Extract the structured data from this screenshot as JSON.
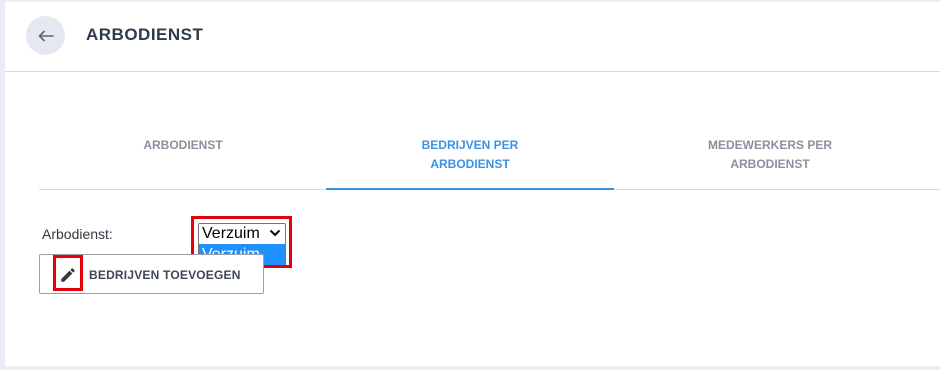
{
  "header": {
    "title": "ARBODIENST",
    "back_icon": "arrow-left-icon"
  },
  "tabs": [
    {
      "label": "ARBODIENST",
      "active": false
    },
    {
      "label": "BEDRIJVEN PER ARBODIENST",
      "active": true
    },
    {
      "label": "MEDEWERKERS PER ARBODIENST",
      "active": false
    }
  ],
  "form": {
    "field_label": "Arbodienst:",
    "select_value": "Verzuim",
    "options": [
      "Verzuim"
    ]
  },
  "actions": {
    "add_button_label": "BEDRIJVEN TOEVOEGEN",
    "add_button_icon": "pencil-icon"
  },
  "colors": {
    "accent": "#3c91e6",
    "highlight": "#e5000a",
    "selected_option": "#1e90ff"
  }
}
